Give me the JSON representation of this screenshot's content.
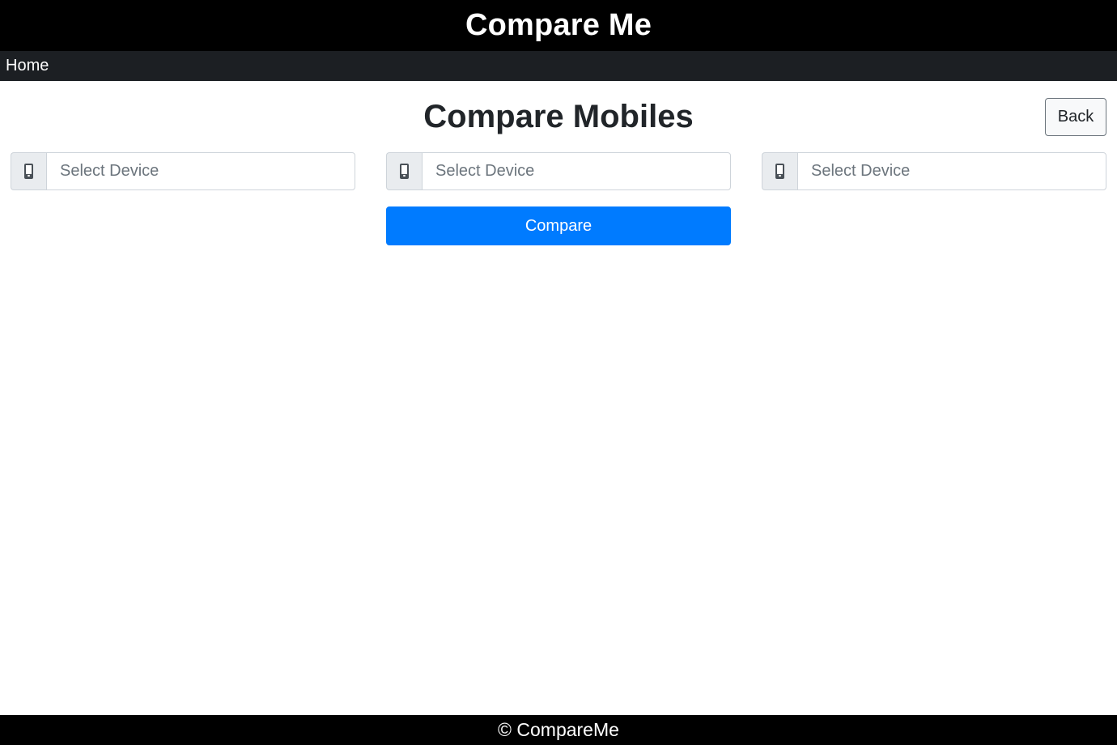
{
  "header": {
    "title": "Compare Me"
  },
  "nav": {
    "home_label": "Home"
  },
  "main": {
    "title": "Compare Mobiles",
    "back_label": "Back",
    "device_inputs": [
      {
        "icon": "mobile-icon",
        "placeholder": "Select Device",
        "value": ""
      },
      {
        "icon": "mobile-icon",
        "placeholder": "Select Device",
        "value": ""
      },
      {
        "icon": "mobile-icon",
        "placeholder": "Select Device",
        "value": ""
      }
    ],
    "compare_label": "Compare"
  },
  "footer": {
    "text": "© CompareMe"
  },
  "colors": {
    "header_bg": "#000000",
    "nav_bg": "#1c1f23",
    "primary": "#007bff",
    "addon_bg": "#e9ecef"
  }
}
